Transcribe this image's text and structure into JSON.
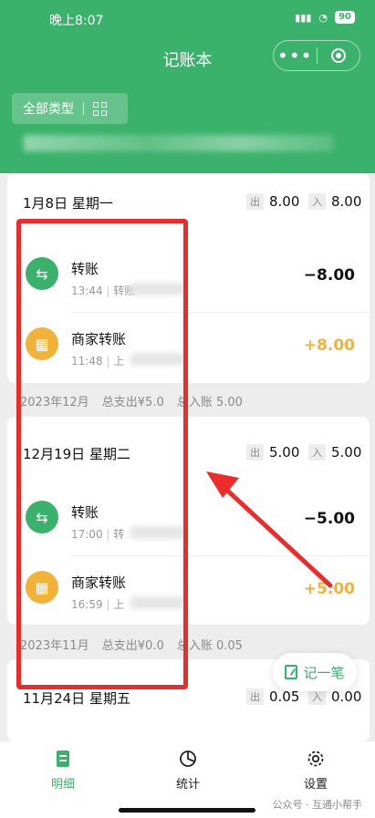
{
  "status_bar": {
    "time": "晚上8:07",
    "battery": "90"
  },
  "header": {
    "title": "记账本",
    "filter_label": "全部类型"
  },
  "days": [
    {
      "date": "1月8日 星期一",
      "out_label": "出",
      "out_value": "8.00",
      "in_label": "入",
      "in_value": "8.00",
      "transactions": [
        {
          "name": "转账",
          "time": "13:44",
          "meta_extra": "转账",
          "amount": "−8.00",
          "icon": "transfer-arrows-icon"
        },
        {
          "name": "商家转账",
          "time": "11:48",
          "meta_extra": "上",
          "amount": "+8.00",
          "icon": "shop-icon"
        }
      ]
    },
    {
      "date": "12月19日 星期二",
      "out_label": "出",
      "out_value": "5.00",
      "in_label": "入",
      "in_value": "5.00",
      "transactions": [
        {
          "name": "转账",
          "time": "17:00",
          "meta_extra": "转",
          "amount": "−5.00",
          "icon": "transfer-arrows-icon"
        },
        {
          "name": "商家转账",
          "time": "16:59",
          "meta_extra": "上",
          "amount": "+5.00",
          "icon": "shop-icon"
        }
      ]
    },
    {
      "date": "11月24日 星期五",
      "out_label": "出",
      "out_value": "0.05",
      "in_label": "入",
      "in_value": "0.00"
    }
  ],
  "months": [
    {
      "label": "2023年12月",
      "spend": "总支出¥5.0",
      "income": "总入账 5.00"
    },
    {
      "label": "2023年11月",
      "spend": "总支出¥0.0",
      "income": "总入账 0.05"
    }
  ],
  "record_button": "记一笔",
  "tabs": [
    {
      "label": "明细",
      "icon": "list-icon"
    },
    {
      "label": "统计",
      "icon": "pie-chart-icon"
    },
    {
      "label": "设置",
      "icon": "gear-icon"
    }
  ],
  "watermark": "公众号 · 互通小帮手",
  "colors": {
    "brand": "#3bb26b",
    "income": "#f2b23a",
    "annotation": "#ee2b2b"
  }
}
